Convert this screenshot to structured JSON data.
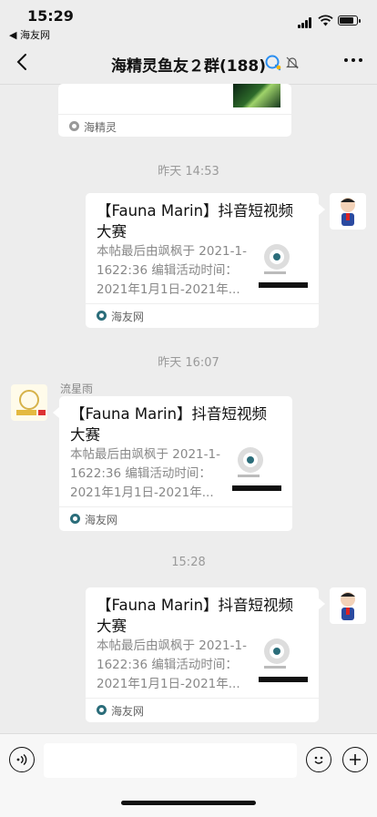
{
  "status": {
    "time": "15:29",
    "back_app": "◀ 海友网"
  },
  "nav": {
    "title": "海精灵鱼友２群(188)"
  },
  "top_card": {
    "source": "海精灵"
  },
  "messages": [
    {
      "time": "昨天 14:53",
      "card": {
        "title": "【Fauna Marin】抖音短视频大赛",
        "desc": "本帖最后由飒枫于 2021-1-1622:36 编辑活动时间：2021年1月1日-2021年...",
        "source": "海友网"
      }
    },
    {
      "time": "昨天 16:07",
      "sender": "流星雨",
      "card": {
        "title": "【Fauna Marin】抖音短视频大赛",
        "desc": "本帖最后由飒枫于 2021-1-1622:36 编辑活动时间：2021年1月1日-2021年...",
        "source": "海友网"
      }
    },
    {
      "time": "15:28",
      "card": {
        "title": "【Fauna Marin】抖音短视频大赛",
        "desc": "本帖最后由飒枫于 2021-1-1622:36 编辑活动时间：2021年1月1日-2021年...",
        "source": "海友网"
      }
    }
  ],
  "colors": {
    "background": "#ededed",
    "bubble": "#ffffff",
    "timestamp": "#9a9a9a",
    "source_icon": "#2b6d7a"
  },
  "icons": [
    "back-chevron-icon",
    "wechat-work-icon",
    "mute-bell-icon",
    "more-icon",
    "voice-icon",
    "emoji-icon",
    "add-icon"
  ]
}
